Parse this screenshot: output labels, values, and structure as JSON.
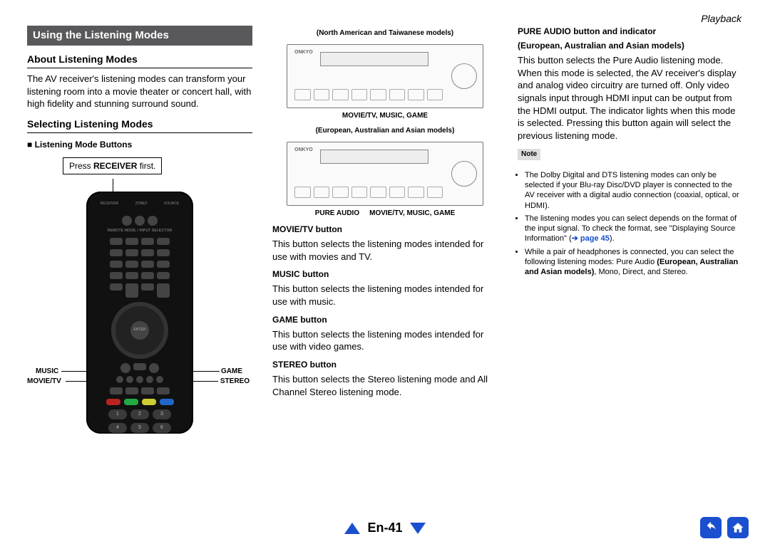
{
  "header": {
    "section": "Playback"
  },
  "titlebar": "Using the Listening Modes",
  "col1": {
    "h_about": "About Listening Modes",
    "p_about": "The AV receiver's listening modes can transform your listening room into a movie theater or concert hall, with high fidelity and stunning surround sound.",
    "h_select": "Selecting Listening Modes",
    "h_buttons": "Listening Mode Buttons",
    "callout_pre": "Press ",
    "callout_bold": "RECEIVER",
    "callout_post": " first.",
    "lbl_music": "MUSIC",
    "lbl_movietv": "MOVIE/TV",
    "lbl_game": "GAME",
    "lbl_stereo": "STEREO"
  },
  "col2": {
    "cap_na": "(North American and Taiwanese models)",
    "cap_na_btns": "MOVIE/TV, MUSIC, GAME",
    "cap_eu": "(European, Australian and Asian models)",
    "cap_eu_left": "PURE AUDIO",
    "cap_eu_right": "MOVIE/TV, MUSIC, GAME",
    "h_movie": "MOVIE/TV button",
    "p_movie": "This button selects the listening modes intended for use with movies and TV.",
    "h_music": "MUSIC button",
    "p_music": "This button selects the listening modes intended for use with music.",
    "h_game": "GAME button",
    "p_game": "This button selects the listening modes intended for use with video games.",
    "h_stereo": "STEREO button",
    "p_stereo": "This button selects the Stereo listening mode and All Channel Stereo listening mode."
  },
  "col3": {
    "h_pure1": "PURE AUDIO button and indicator",
    "h_pure2": "(European, Australian and Asian models)",
    "p_pure": "This button selects the Pure Audio listening mode. When this mode is selected, the AV receiver's display and analog video circuitry are turned off. Only video signals input through HDMI input can be output from the HDMI output. The indicator lights when this mode is selected. Pressing this button again will select the previous listening mode.",
    "note_label": "Note",
    "notes": [
      {
        "text": "The Dolby Digital and DTS listening modes can only be selected if your Blu-ray Disc/DVD player is connected to the AV receiver with a digital audio connection (coaxial, optical, or HDMI)."
      },
      {
        "pre": "The listening modes you can select depends on the format of the input signal. To check the format, see \"Displaying Source Information\" (",
        "link": "➔ page 45",
        "post": ")."
      },
      {
        "pre": "While a pair of headphones is connected, you can select the following listening modes: Pure Audio ",
        "bold": "(European, Australian and Asian models)",
        "post": ", Mono, Direct, and Stereo."
      }
    ]
  },
  "footer": {
    "page": "En-41"
  }
}
